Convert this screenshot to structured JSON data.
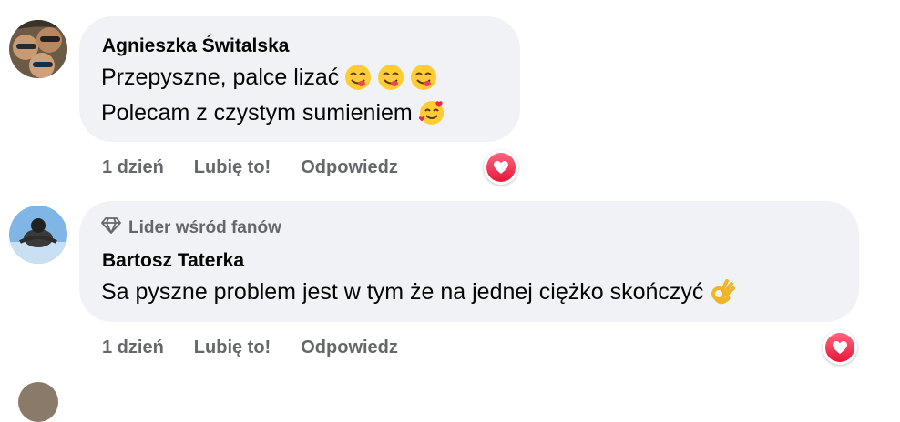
{
  "comments": [
    {
      "author": "Agnieszka Świtalska",
      "line1": "Przepyszne, palce lizać",
      "line2": "Polecam z czystym sumieniem",
      "line1_emojis": [
        "face-savoring-food",
        "face-savoring-food",
        "face-savoring-food"
      ],
      "line2_emojis": [
        "smiling-face-with-hearts"
      ],
      "time": "1 dzień",
      "like_label": "Lubię to!",
      "reply_label": "Odpowiedz",
      "reaction": "love"
    },
    {
      "badge": "Lider wśród fanów",
      "badge_icon": "diamond-icon",
      "author": "Bartosz Taterka",
      "line1": "Sa pyszne problem jest w tym że na jednej ciężko skończyć",
      "line1_emojis": [
        "ok-hand"
      ],
      "time": "1 dzień",
      "like_label": "Lubię to!",
      "reply_label": "Odpowiedz",
      "reaction": "love"
    }
  ],
  "colors": {
    "bubble": "#f0f2f5",
    "secondary_text": "#65676b",
    "love_reaction": "#f33e58"
  }
}
